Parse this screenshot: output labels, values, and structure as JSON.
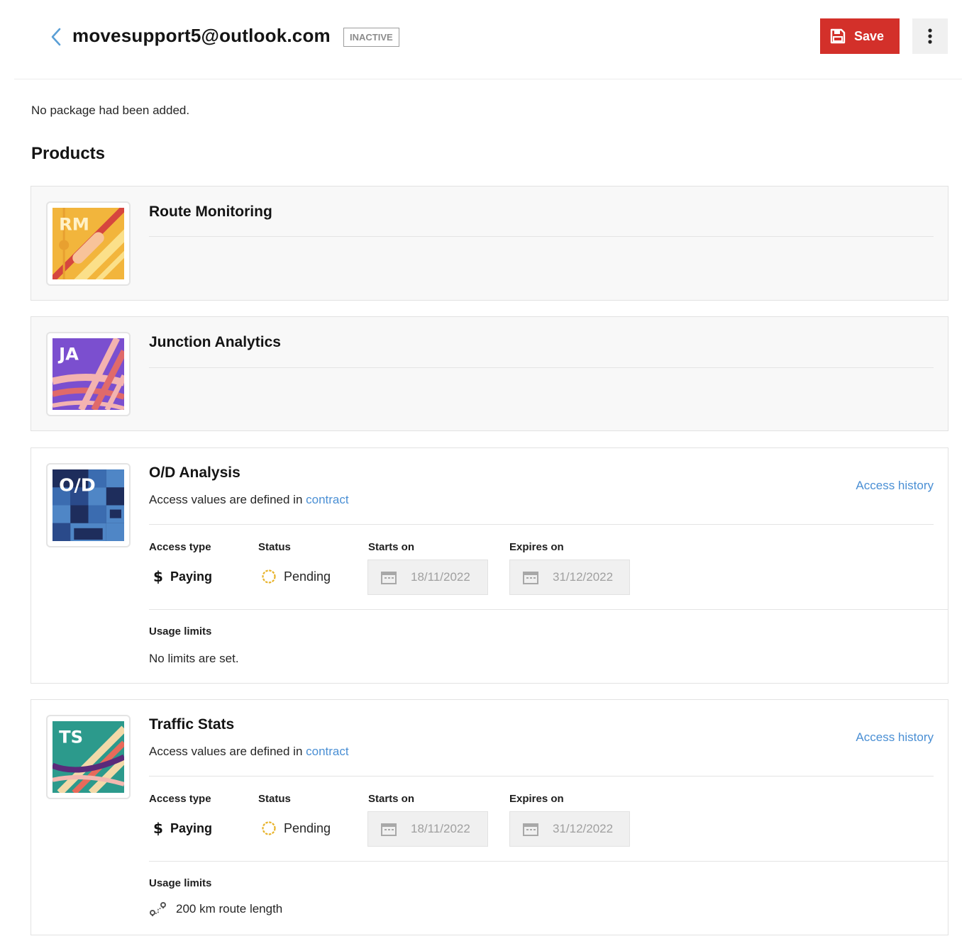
{
  "header": {
    "title": "movesupport5@outlook.com",
    "status_badge": "INACTIVE",
    "save_label": "Save",
    "back_icon": "chevron-left-icon",
    "save_icon": "floppy-disk-icon",
    "more_icon": "vertical-ellipsis-icon"
  },
  "notice": "No package had been added.",
  "section_title": "Products",
  "colors": {
    "accent": "#d3302a",
    "link": "#4a8fd4",
    "pending": "#e8b32a"
  },
  "products": [
    {
      "name": "Route Monitoring",
      "logo_text": "RM"
    },
    {
      "name": "Junction Analytics",
      "logo_text": "JA"
    },
    {
      "name": "O/D Analysis",
      "logo_text": "O/D",
      "contract_prefix": "Access values are defined in ",
      "contract_link": "contract",
      "access_history": "Access history",
      "labels": {
        "access_type": "Access type",
        "status": "Status",
        "starts_on": "Starts on",
        "expires_on": "Expires on"
      },
      "access_type": "Paying",
      "status": "Pending",
      "starts_on": "18/11/2022",
      "expires_on": "31/12/2022",
      "usage_label": "Usage limits",
      "usage_text": "No limits are set."
    },
    {
      "name": "Traffic Stats",
      "logo_text": "TS",
      "contract_prefix": "Access values are defined in ",
      "contract_link": "contract",
      "access_history": "Access history",
      "labels": {
        "access_type": "Access type",
        "status": "Status",
        "starts_on": "Starts on",
        "expires_on": "Expires on"
      },
      "access_type": "Paying",
      "status": "Pending",
      "starts_on": "18/11/2022",
      "expires_on": "31/12/2022",
      "usage_label": "Usage limits",
      "usage_text": "200 km route length"
    }
  ]
}
